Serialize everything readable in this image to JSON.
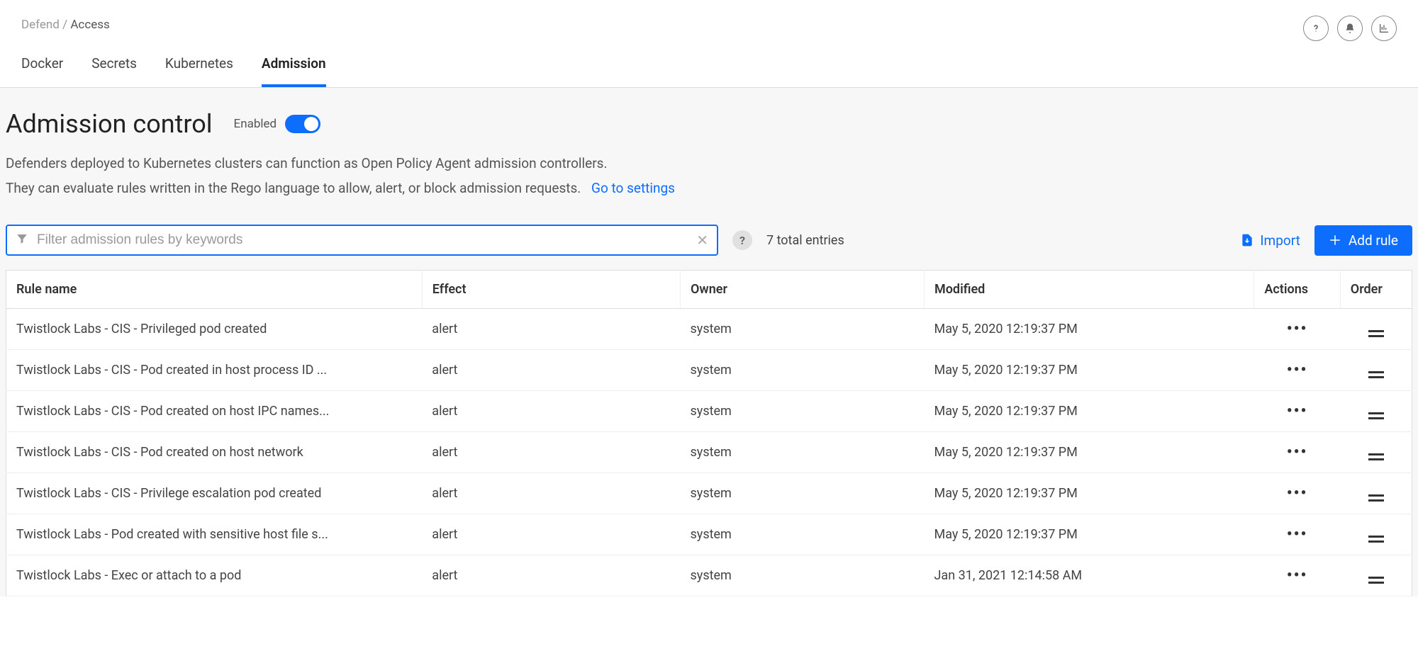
{
  "breadcrumb": {
    "parent": "Defend",
    "sep": " / ",
    "current": "Access"
  },
  "tabs": [
    "Docker",
    "Secrets",
    "Kubernetes",
    "Admission"
  ],
  "activeTab": 3,
  "page": {
    "title": "Admission control",
    "toggleLabel": "Enabled",
    "desc1": "Defenders deployed to Kubernetes clusters can function as Open Policy Agent admission controllers.",
    "desc2": "They can evaluate rules written in the Rego language to allow, alert, or block admission requests.",
    "settingsLink": "Go to settings"
  },
  "filter": {
    "placeholder": "Filter admission rules by keywords",
    "value": ""
  },
  "entriesText": "7 total entries",
  "importLabel": "Import",
  "addLabel": "Add rule",
  "columns": {
    "name": "Rule name",
    "effect": "Effect",
    "owner": "Owner",
    "modified": "Modified",
    "actions": "Actions",
    "order": "Order"
  },
  "rows": [
    {
      "name": "Twistlock Labs - CIS - Privileged pod created",
      "effect": "alert",
      "owner": "system",
      "modified": "May 5, 2020 12:19:37 PM"
    },
    {
      "name": "Twistlock Labs - CIS - Pod created in host process ID ...",
      "effect": "alert",
      "owner": "system",
      "modified": "May 5, 2020 12:19:37 PM"
    },
    {
      "name": "Twistlock Labs - CIS - Pod created on host IPC names...",
      "effect": "alert",
      "owner": "system",
      "modified": "May 5, 2020 12:19:37 PM"
    },
    {
      "name": "Twistlock Labs - CIS - Pod created on host network",
      "effect": "alert",
      "owner": "system",
      "modified": "May 5, 2020 12:19:37 PM"
    },
    {
      "name": "Twistlock Labs - CIS - Privilege escalation pod created",
      "effect": "alert",
      "owner": "system",
      "modified": "May 5, 2020 12:19:37 PM"
    },
    {
      "name": "Twistlock Labs - Pod created with sensitive host file s...",
      "effect": "alert",
      "owner": "system",
      "modified": "May 5, 2020 12:19:37 PM"
    },
    {
      "name": "Twistlock Labs - Exec or attach to a pod",
      "effect": "alert",
      "owner": "system",
      "modified": "Jan 31, 2021 12:14:58 AM"
    }
  ]
}
